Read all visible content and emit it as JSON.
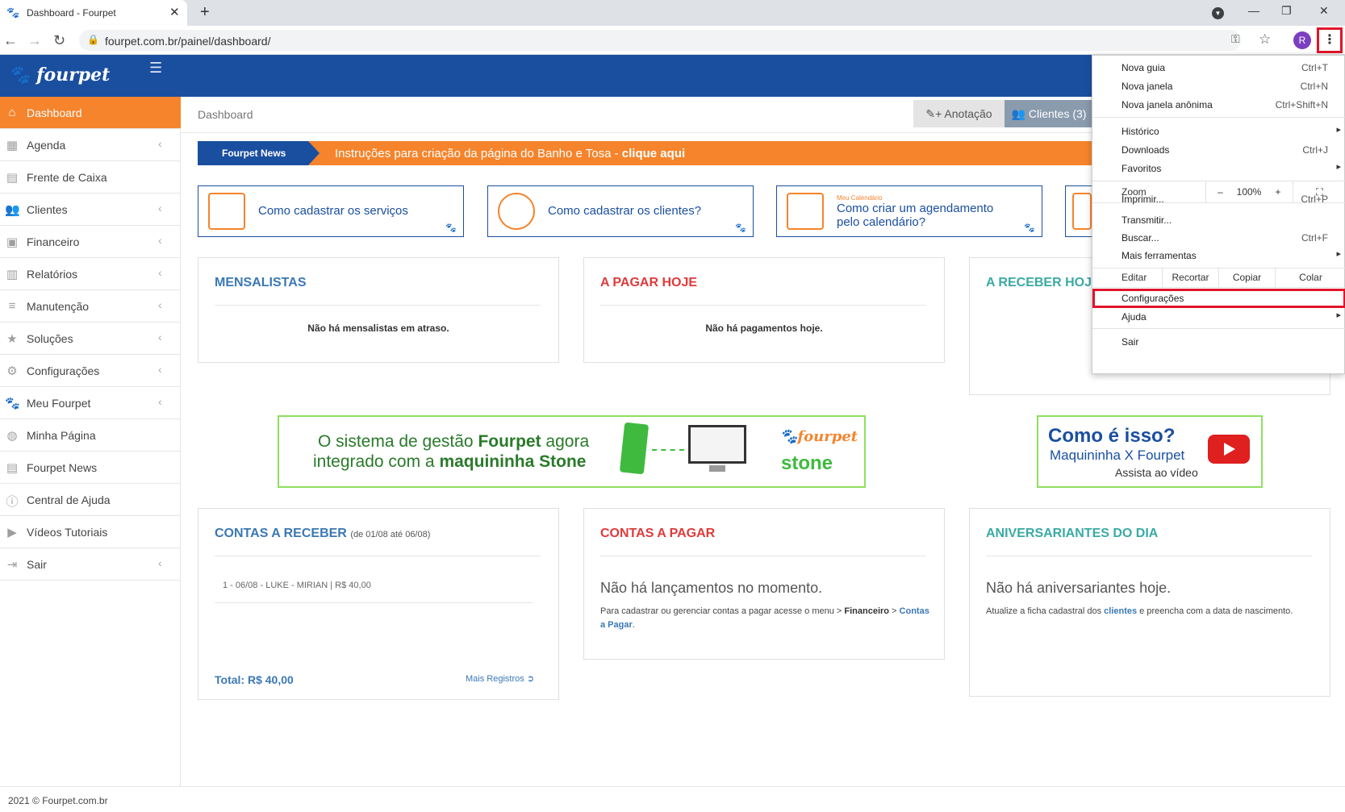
{
  "browser": {
    "tab_title": "Dashboard - Fourpet",
    "url": "fourpet.com.br/painel/dashboard/",
    "avatar_letter": "R"
  },
  "app": {
    "logo": "fourpet"
  },
  "sidebar": {
    "items": [
      {
        "label": "Dashboard",
        "icon": "home-icon",
        "active": true
      },
      {
        "label": "Agenda",
        "icon": "calendar-icon",
        "chevron": true
      },
      {
        "label": "Frente de Caixa",
        "icon": "register-icon"
      },
      {
        "label": "Clientes",
        "icon": "users-icon",
        "chevron": true
      },
      {
        "label": "Financeiro",
        "icon": "money-icon",
        "chevron": true
      },
      {
        "label": "Relatórios",
        "icon": "bar-chart-icon",
        "chevron": true
      },
      {
        "label": "Manutenção",
        "icon": "database-icon",
        "chevron": true
      },
      {
        "label": "Soluções",
        "icon": "star-icon",
        "chevron": true
      },
      {
        "label": "Configurações",
        "icon": "gears-icon",
        "chevron": true
      },
      {
        "label": "Meu Fourpet",
        "icon": "paw-icon",
        "chevron": true
      },
      {
        "label": "Minha Página",
        "icon": "globe-icon"
      },
      {
        "label": "Fourpet News",
        "icon": "newspaper-icon"
      },
      {
        "label": "Central de Ajuda",
        "icon": "info-icon"
      },
      {
        "label": "Vídeos Tutoriais",
        "icon": "video-icon"
      },
      {
        "label": "Sair",
        "icon": "sign-out-icon",
        "chevron": true
      }
    ]
  },
  "main": {
    "page_title": "Dashboard",
    "btn_annotation": "+ Anotação",
    "btn_clients": "Clientes (3)",
    "news": {
      "tag": "Fourpet News",
      "message": "Instruções para criação da página do Banho e Tosa - ",
      "link": "clique aqui"
    },
    "help_cards": [
      {
        "label": "Como cadastrar os serviços"
      },
      {
        "label": "Como cadastrar os clientes?"
      },
      {
        "small": "Meu Calendário",
        "line1": "Como criar um agendamento",
        "line2": "pelo calendário?"
      }
    ],
    "panels": {
      "mensalistas": {
        "title": "MENSALISTAS",
        "text": "Não há mensalistas em atraso."
      },
      "apagar_hoje": {
        "title": "A PAGAR HOJE",
        "text": "Não há pagamentos hoje."
      },
      "areceber_hoje": {
        "title": "A RECEBER HOJE"
      },
      "contas_receber": {
        "title": "CONTAS A RECEBER",
        "subtitle": "(de 01/08 até 06/08)",
        "row": "1 - 06/08 - LUKE - MIRIAN | R$ 40,00",
        "total": "Total: R$ 40,00",
        "more": "Mais Registros"
      },
      "contas_pagar": {
        "title": "CONTAS A PAGAR",
        "big": "Não há lançamentos no momento.",
        "small_pre": "Para cadastrar ou gerenciar contas a pagar acesse o menu > ",
        "small_b1": "Financeiro",
        "small_mid": " > ",
        "small_link": "Contas a Pagar",
        "small_end": "."
      },
      "aniversariantes": {
        "title": "ANIVERSARIANTES DO DIA",
        "big": "Não há aniversariantes hoje.",
        "small_pre": "Atualize a ficha cadastral dos ",
        "small_link": "clientes",
        "small_end": " e preencha com a data de nascimento."
      }
    },
    "banner_stone": {
      "line1_pre": "O sistema de gestão ",
      "line1_b": "Fourpet",
      "line1_post": " agora",
      "line2_pre": "integrado com a ",
      "line2_b": "maquininha Stone",
      "logo": "fourpet",
      "stone": "stone"
    },
    "banner_video": {
      "line1": "Como é isso?",
      "line2": "Maquininha X Fourpet",
      "line3": "Assista ao vídeo"
    }
  },
  "footer": {
    "text": "2021 © Fourpet.com.br"
  },
  "chrome_menu": {
    "items": [
      {
        "label": "Nova guia",
        "shortcut": "Ctrl+T"
      },
      {
        "label": "Nova janela",
        "shortcut": "Ctrl+N"
      },
      {
        "label": "Nova janela anônima",
        "shortcut": "Ctrl+Shift+N"
      },
      {
        "label": "Histórico",
        "submenu": true
      },
      {
        "label": "Downloads",
        "shortcut": "Ctrl+J"
      },
      {
        "label": "Favoritos",
        "submenu": true
      },
      {
        "label": "Imprimir...",
        "shortcut": "Ctrl+P"
      },
      {
        "label": "Transmitir..."
      },
      {
        "label": "Buscar...",
        "shortcut": "Ctrl+F"
      },
      {
        "label": "Mais ferramentas",
        "submenu": true
      },
      {
        "label": "Configurações"
      },
      {
        "label": "Ajuda",
        "submenu": true
      },
      {
        "label": "Sair"
      }
    ],
    "zoom": {
      "label": "Zoom",
      "minus": "–",
      "value": "100%",
      "plus": "+"
    },
    "edit": {
      "label": "Editar",
      "cut": "Recortar",
      "copy": "Copiar",
      "paste": "Colar"
    }
  },
  "colors": {
    "brand_blue": "#1a4fa0",
    "brand_orange": "#f5842c",
    "highlight_red": "#e0142a"
  }
}
